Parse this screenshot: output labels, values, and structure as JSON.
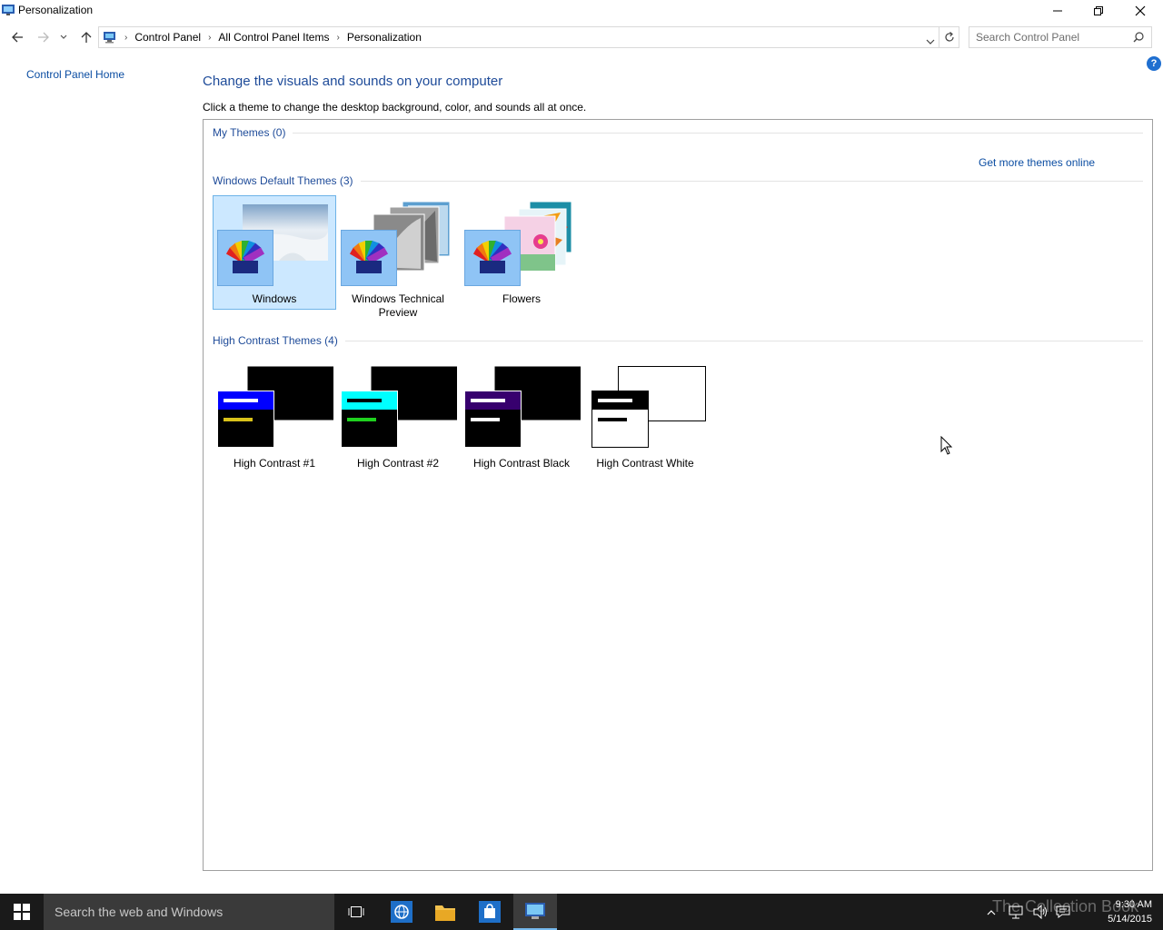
{
  "window": {
    "title": "Personalization"
  },
  "navigation": {
    "breadcrumbs": [
      "Control Panel",
      "All Control Panel Items",
      "Personalization"
    ],
    "search_placeholder": "Search Control Panel"
  },
  "sidebar": {
    "home_link": "Control Panel Home"
  },
  "main": {
    "title": "Change the visuals and sounds on your computer",
    "subtitle": "Click a theme to change the desktop background, color, and sounds all at once.",
    "get_more_link": "Get more themes online",
    "groups": [
      {
        "label": "My Themes (0)",
        "themes": []
      },
      {
        "label": "Windows Default Themes (3)",
        "themes": [
          {
            "label": "Windows",
            "selected": true
          },
          {
            "label": "Windows Technical Preview",
            "selected": false
          },
          {
            "label": "Flowers",
            "selected": false
          }
        ]
      },
      {
        "label": "High Contrast Themes (4)",
        "themes": [
          {
            "label": "High Contrast #1"
          },
          {
            "label": "High Contrast #2"
          },
          {
            "label": "High Contrast Black"
          },
          {
            "label": "High Contrast White"
          }
        ]
      }
    ]
  },
  "taskbar": {
    "search_text": "Search the web and Windows",
    "time": "9:30 AM",
    "date": "5/14/2015",
    "watermark": "The Collection Book"
  },
  "colors": {
    "link": "#0b4da2",
    "heading": "#1e4b99",
    "selection": "#cce8ff",
    "taskbar": "#1a1a1a"
  }
}
